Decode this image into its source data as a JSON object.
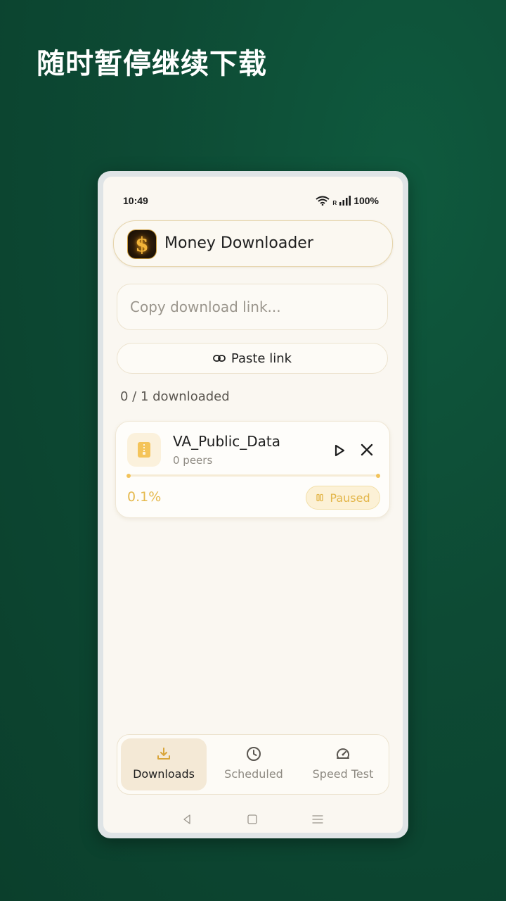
{
  "promo": {
    "title": "随时暂停继续下载"
  },
  "status_bar": {
    "time": "10:49",
    "roaming": "R",
    "battery": "100%"
  },
  "app": {
    "title": "Money Downloader",
    "logo_symbol": "$",
    "logo_icon": "dollar-coin-icon"
  },
  "input": {
    "placeholder": "Copy download link..."
  },
  "paste_button": {
    "label": "Paste link",
    "icon": "link-icon"
  },
  "counter": {
    "text": "0 / 1 downloaded"
  },
  "downloads": [
    {
      "name": "VA_Public_Data",
      "peers": "0 peers",
      "progress_label": "0.1%",
      "progress_fraction": 0.001,
      "status": "Paused",
      "file_icon": "zip-file-icon"
    }
  ],
  "nav": {
    "items": [
      {
        "label": "Downloads",
        "icon": "download-icon",
        "active": true
      },
      {
        "label": "Scheduled",
        "icon": "clock-icon",
        "active": false
      },
      {
        "label": "Speed Test",
        "icon": "speedometer-icon",
        "active": false
      }
    ]
  },
  "colors": {
    "accent": "#e5b94d",
    "background_green": "#0d4a34",
    "surface": "#faf7f1"
  }
}
